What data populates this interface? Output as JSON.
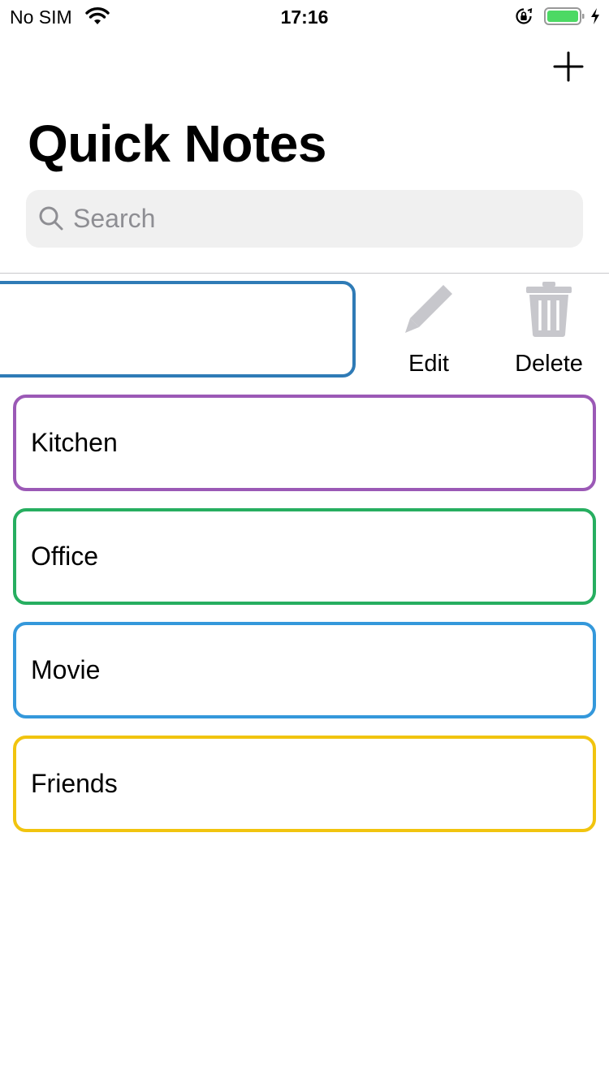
{
  "status_bar": {
    "carrier": "No SIM",
    "time": "17:16",
    "battery_color": "#4cd964"
  },
  "header": {
    "title": "Quick Notes",
    "add_icon": "plus-icon"
  },
  "search": {
    "placeholder": "Search",
    "value": ""
  },
  "swiped_row": {
    "border_color": "#2f7bb6",
    "actions": [
      {
        "label": "Edit",
        "icon": "pencil-icon"
      },
      {
        "label": "Delete",
        "icon": "trash-icon"
      }
    ]
  },
  "notes": [
    {
      "label": "Kitchen",
      "color": "#9b59b6"
    },
    {
      "label": "Office",
      "color": "#27ae60"
    },
    {
      "label": "Movie",
      "color": "#3498db"
    },
    {
      "label": "Friends",
      "color": "#f1c40f"
    }
  ]
}
